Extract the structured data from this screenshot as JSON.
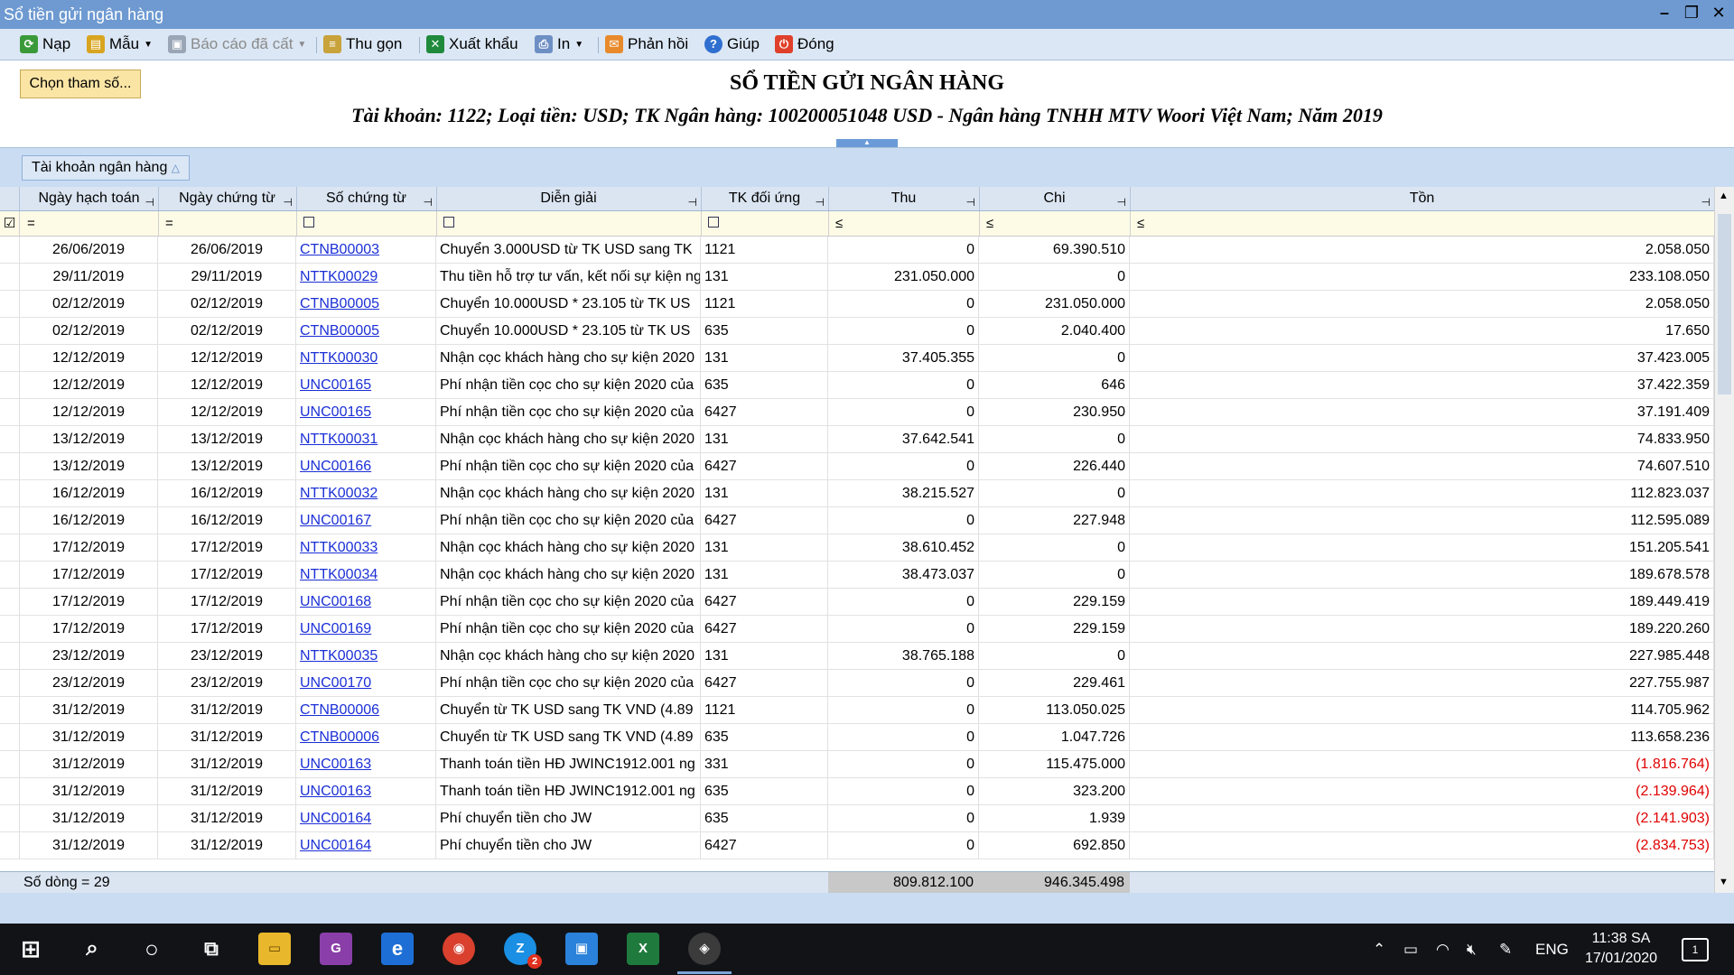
{
  "window": {
    "title": "Sổ tiền gửi ngân hàng"
  },
  "toolbar": {
    "refresh": "Nạp",
    "template": "Mẫu",
    "saved_reports": "Báo cáo đã cất",
    "collapse": "Thu gọn",
    "export": "Xuất khẩu",
    "print": "In",
    "feedback": "Phản hồi",
    "help": "Giúp",
    "close": "Đóng"
  },
  "header": {
    "param_button": "Chọn tham số...",
    "title": "SỔ TIỀN GỬI NGÂN HÀNG",
    "subtitle": "Tài khoản: 1122; Loại tiền: USD; TK Ngân hàng: 100200051048 USD - Ngân hàng TNHH MTV Woori Việt Nam; Năm 2019"
  },
  "group": {
    "tag": "Tài khoản ngân hàng"
  },
  "columns": [
    "Ngày hạch toán",
    "Ngày chứng từ",
    "Số chứng từ",
    "Diễn giải",
    "TK đối ứng",
    "Thu",
    "Chi",
    "Tồn"
  ],
  "filters": [
    "=",
    "=",
    "",
    "",
    "",
    "≤",
    "≤",
    "≤"
  ],
  "rows": [
    [
      "26/06/2019",
      "26/06/2019",
      "CTNB00003",
      "Chuyển 3.000USD từ TK USD sang TK",
      "1121",
      "0",
      "69.390.510",
      "2.058.050"
    ],
    [
      "29/11/2019",
      "29/11/2019",
      "NTTK00029",
      "Thu tiền hỗ trợ tư vấn, kết nối sự kiện ng",
      "131",
      "231.050.000",
      "0",
      "233.108.050"
    ],
    [
      "02/12/2019",
      "02/12/2019",
      "CTNB00005",
      "Chuyển 10.000USD * 23.105 từ TK US",
      "1121",
      "0",
      "231.050.000",
      "2.058.050"
    ],
    [
      "02/12/2019",
      "02/12/2019",
      "CTNB00005",
      "Chuyển 10.000USD * 23.105 từ TK US",
      "635",
      "0",
      "2.040.400",
      "17.650"
    ],
    [
      "12/12/2019",
      "12/12/2019",
      "NTTK00030",
      "Nhận cọc khách hàng cho sự kiện 2020",
      "131",
      "37.405.355",
      "0",
      "37.423.005"
    ],
    [
      "12/12/2019",
      "12/12/2019",
      "UNC00165",
      "Phí nhận tiền cọc cho sự kiện 2020 của",
      "635",
      "0",
      "646",
      "37.422.359"
    ],
    [
      "12/12/2019",
      "12/12/2019",
      "UNC00165",
      "Phí nhận tiền cọc cho sự kiện 2020 của",
      "6427",
      "0",
      "230.950",
      "37.191.409"
    ],
    [
      "13/12/2019",
      "13/12/2019",
      "NTTK00031",
      "Nhận cọc khách hàng cho sự kiện 2020",
      "131",
      "37.642.541",
      "0",
      "74.833.950"
    ],
    [
      "13/12/2019",
      "13/12/2019",
      "UNC00166",
      "Phí nhận tiền cọc cho sự kiện 2020 của",
      "6427",
      "0",
      "226.440",
      "74.607.510"
    ],
    [
      "16/12/2019",
      "16/12/2019",
      "NTTK00032",
      "Nhận cọc khách hàng cho sự kiện 2020",
      "131",
      "38.215.527",
      "0",
      "112.823.037"
    ],
    [
      "16/12/2019",
      "16/12/2019",
      "UNC00167",
      "Phí nhận tiền cọc cho sự kiện 2020 của",
      "6427",
      "0",
      "227.948",
      "112.595.089"
    ],
    [
      "17/12/2019",
      "17/12/2019",
      "NTTK00033",
      "Nhận cọc khách hàng cho sự kiện 2020",
      "131",
      "38.610.452",
      "0",
      "151.205.541"
    ],
    [
      "17/12/2019",
      "17/12/2019",
      "NTTK00034",
      "Nhận cọc khách hàng cho sự kiện 2020",
      "131",
      "38.473.037",
      "0",
      "189.678.578"
    ],
    [
      "17/12/2019",
      "17/12/2019",
      "UNC00168",
      "Phí nhận tiền cọc cho sự kiện 2020 của",
      "6427",
      "0",
      "229.159",
      "189.449.419"
    ],
    [
      "17/12/2019",
      "17/12/2019",
      "UNC00169",
      "Phí nhận tiền cọc cho sự kiện 2020 của",
      "6427",
      "0",
      "229.159",
      "189.220.260"
    ],
    [
      "23/12/2019",
      "23/12/2019",
      "NTTK00035",
      "Nhận cọc khách hàng cho sự kiện 2020",
      "131",
      "38.765.188",
      "0",
      "227.985.448"
    ],
    [
      "23/12/2019",
      "23/12/2019",
      "UNC00170",
      "Phí nhận tiền cọc cho sự kiện 2020 của",
      "6427",
      "0",
      "229.461",
      "227.755.987"
    ],
    [
      "31/12/2019",
      "31/12/2019",
      "CTNB00006",
      "Chuyển từ TK USD sang TK VND (4.89",
      "1121",
      "0",
      "113.050.025",
      "114.705.962"
    ],
    [
      "31/12/2019",
      "31/12/2019",
      "CTNB00006",
      "Chuyển từ TK USD sang TK VND (4.89",
      "635",
      "0",
      "1.047.726",
      "113.658.236"
    ],
    [
      "31/12/2019",
      "31/12/2019",
      "UNC00163",
      "Thanh toán tiền HĐ JWINC1912.001 ng",
      "331",
      "0",
      "115.475.000",
      "(1.816.764)"
    ],
    [
      "31/12/2019",
      "31/12/2019",
      "UNC00163",
      "Thanh toán tiền HĐ JWINC1912.001 ng",
      "635",
      "0",
      "323.200",
      "(2.139.964)"
    ],
    [
      "31/12/2019",
      "31/12/2019",
      "UNC00164",
      "Phí chuyển tiền cho JW",
      "635",
      "0",
      "1.939",
      "(2.141.903)"
    ],
    [
      "31/12/2019",
      "31/12/2019",
      "UNC00164",
      "Phí chuyển tiền cho JW",
      "6427",
      "0",
      "692.850",
      "(2.834.753)"
    ]
  ],
  "footer": {
    "row_count": "Số dòng = 29",
    "total_thu": "809.812.100",
    "total_chi": "946.345.498"
  },
  "taskbar": {
    "lang": "ENG",
    "time": "11:38 SA",
    "date": "17/01/2020",
    "notif_count": "1",
    "zalo_badge": "2"
  },
  "colors": {
    "titlebar": "#6e9ad1",
    "link": "#1b2fd6",
    "negative": "#e00000",
    "param_button": "#fbe5a5"
  }
}
